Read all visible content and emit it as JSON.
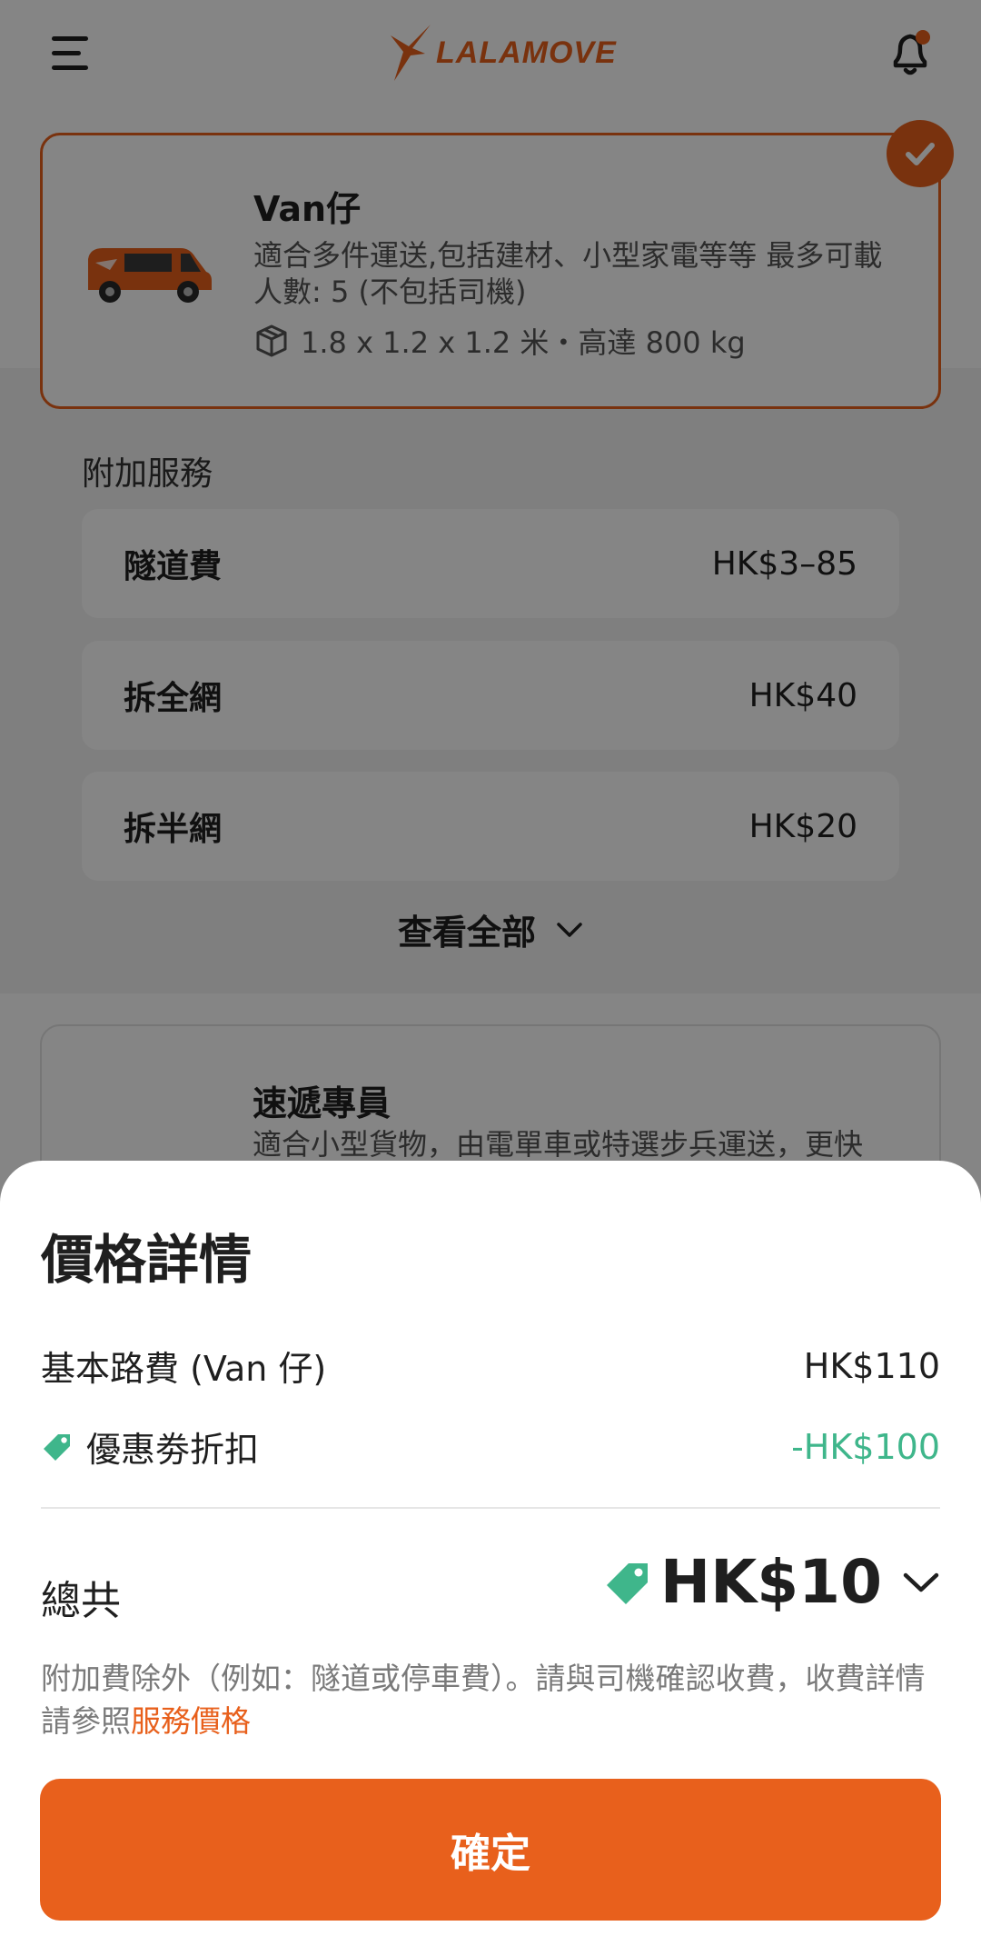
{
  "header": {
    "logo_text": "LALAMOVE"
  },
  "vehicle": {
    "name": "Van仔",
    "description": "適合多件運送,包括建材、小型家電等等 最多可載人數: 5 (不包括司機)",
    "spec": "1.8 x 1.2 x 1.2 米・高達 800 kg",
    "selected": true
  },
  "addons": {
    "title": "附加服務",
    "items": [
      {
        "name": "隧道費",
        "price": "HK$3–85"
      },
      {
        "name": "拆全網",
        "price": "HK$40"
      },
      {
        "name": "拆半網",
        "price": "HK$20"
      }
    ],
    "view_all": "查看全部"
  },
  "courier": {
    "name": "速遞專員",
    "description": "適合小型貨物，由電單車或特選步兵運送，更快"
  },
  "sheet": {
    "title": "價格詳情",
    "base_fare_label": "基本路費 (Van 仔)",
    "base_fare_value": "HK$110",
    "discount_label": "優惠劵折扣",
    "discount_value": "-HK$100",
    "total_label": "總共",
    "total_value": "HK$10",
    "note_text": "附加費除外（例如：隧道或停車費）。請與司機確認收費，收費詳情請參照",
    "note_link": "服務價格",
    "confirm_label": "確定"
  },
  "colors": {
    "brand": "#e8601c",
    "discount": "#3fb68b"
  }
}
